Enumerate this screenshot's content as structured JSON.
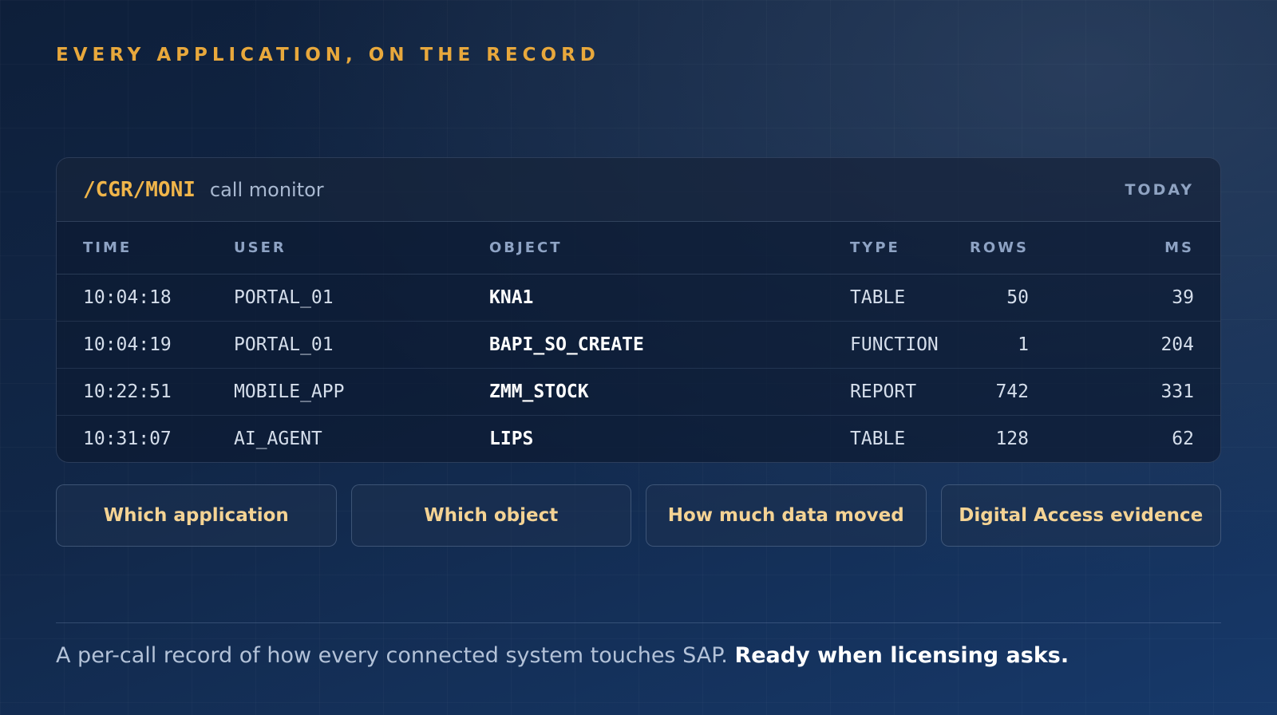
{
  "eyebrow": "EVERY APPLICATION, ON THE RECORD",
  "panel": {
    "tcode": "/CGR/MONI",
    "title": "call monitor",
    "period": "TODAY"
  },
  "table": {
    "headers": [
      "TIME",
      "USER",
      "OBJECT",
      "TYPE",
      "ROWS",
      "MS"
    ],
    "rows": [
      {
        "time": "10:04:18",
        "user": "PORTAL_01",
        "object": "KNA1",
        "type": "TABLE",
        "rows": "50",
        "ms": "39"
      },
      {
        "time": "10:04:19",
        "user": "PORTAL_01",
        "object": "BAPI_SO_CREATE",
        "type": "FUNCTION",
        "rows": "1",
        "ms": "204"
      },
      {
        "time": "10:22:51",
        "user": "MOBILE_APP",
        "object": "ZMM_STOCK",
        "type": "REPORT",
        "rows": "742",
        "ms": "331"
      },
      {
        "time": "10:31:07",
        "user": "AI_AGENT",
        "object": "LIPS",
        "type": "TABLE",
        "rows": "128",
        "ms": "62"
      }
    ]
  },
  "pills": [
    "Which application",
    "Which object",
    "How much data moved",
    "Digital Access evidence"
  ],
  "footer": {
    "text": "A per-call record of how every connected system touches SAP.",
    "emphasis": "Ready when licensing asks."
  },
  "colors": {
    "accent": "#e8a83c",
    "pill_text": "#f4d394",
    "background": "#112748"
  }
}
